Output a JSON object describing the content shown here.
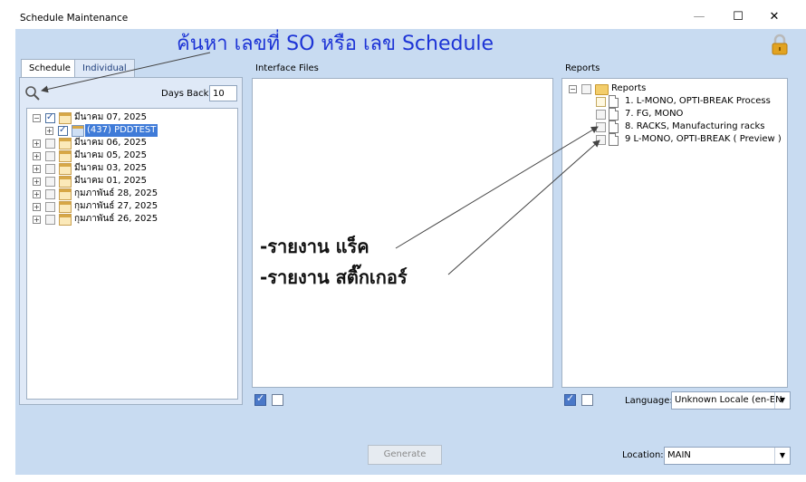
{
  "window": {
    "title": "Schedule Maintenance",
    "minimize_glyph": "—",
    "maximize_glyph": "☐",
    "close_glyph": "✕"
  },
  "annotation_top": "ค้นหา เลขที่ SO หรือ เลข Schedule",
  "annotation_rack": "-รายงาน แร็ค",
  "annotation_sticker": "-รายงาน สติ๊กเกอร์",
  "tabs": [
    {
      "label": "Schedule"
    },
    {
      "label": "Individual"
    }
  ],
  "days_back": {
    "label": "Days Back:",
    "value": "10"
  },
  "schedule_tree": [
    {
      "label": "มีนาคม 07, 2025",
      "checked": true,
      "expanded": true
    },
    {
      "label": "(437) PDDTEST",
      "checked": true,
      "child": true
    },
    {
      "label": "มีนาคม 06, 2025",
      "checked": false
    },
    {
      "label": "มีนาคม 05, 2025",
      "checked": false
    },
    {
      "label": "มีนาคม 03, 2025",
      "checked": false
    },
    {
      "label": "มีนาคม 01, 2025",
      "checked": false
    },
    {
      "label": "กุมภาพันธ์ 28, 2025",
      "checked": false
    },
    {
      "label": "กุมภาพันธ์ 27, 2025",
      "checked": false
    },
    {
      "label": "กุมภาพันธ์ 26, 2025",
      "checked": false
    }
  ],
  "interface_files": {
    "label": "Interface Files"
  },
  "reports": {
    "label": "Reports",
    "root": "Reports",
    "items": [
      "1. L-MONO, OPTI-BREAK Process",
      "7. FG, MONO",
      "8. RACKS, Manufacturing racks",
      "9 L-MONO, OPTI-BREAK ( Preview )"
    ]
  },
  "language": {
    "label": "Language:",
    "value": "Unknown Locale (en-EN"
  },
  "location": {
    "label": "Location:",
    "value": "MAIN"
  },
  "generate_button": "Generate",
  "colors": {
    "accent_blue": "#1d34d6",
    "client_bg": "#c8dbf1",
    "lock": "#e2a321"
  },
  "icons": [
    "search-icon",
    "lock-icon",
    "calendar-icon",
    "document-icon",
    "folder-icon"
  ]
}
